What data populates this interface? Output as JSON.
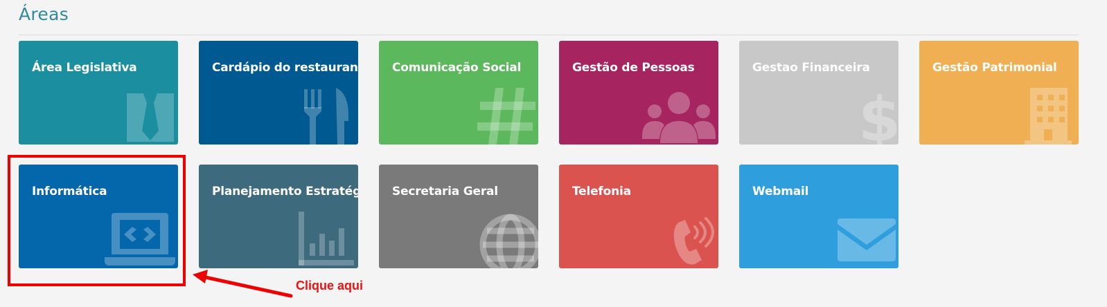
{
  "section": {
    "title": "Áreas"
  },
  "colors": {
    "title": "#2f8a9a",
    "annotation_red": "#ee0000"
  },
  "tiles": [
    {
      "label": "Área Legislativa",
      "color": "#1b8fa0",
      "icon": "tie-icon"
    },
    {
      "label": "Cardápio do restaurante",
      "color": "#005a91",
      "icon": "fork-knife-icon"
    },
    {
      "label": "Comunicação Social",
      "color": "#5cb85c",
      "icon": "hashtag-icon"
    },
    {
      "label": "Gestão de Pessoas",
      "color": "#a6245f",
      "icon": "users-icon"
    },
    {
      "label": "Gestao Financeira",
      "color": "#c8c8c8",
      "icon": "dollar-icon"
    },
    {
      "label": "Gestão Patrimonial",
      "color": "#efaf52",
      "icon": "building-icon"
    },
    {
      "label": "Informática",
      "color": "#0466ab",
      "icon": "laptop-code-icon"
    },
    {
      "label": "Planejamento Estratégico",
      "color": "#3d6a7c",
      "icon": "bar-chart-icon"
    },
    {
      "label": "Secretaria Geral",
      "color": "#7a7a7a",
      "icon": "globe-icon"
    },
    {
      "label": "Telefonia",
      "color": "#da534f",
      "icon": "phone-volume-icon"
    },
    {
      "label": "Webmail",
      "color": "#2f9edd",
      "icon": "envelope-icon"
    }
  ],
  "annotation": {
    "text": "Clique aqui"
  }
}
